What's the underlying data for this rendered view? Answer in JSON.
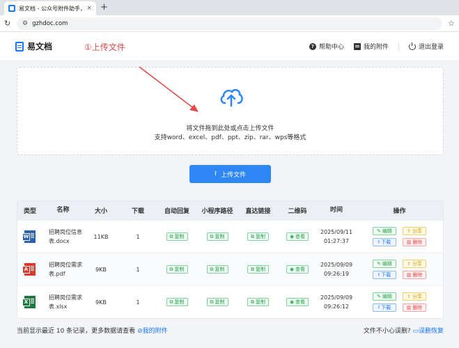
{
  "browser": {
    "tab_title": "易文档 - 公众号附件助手，一键",
    "tab_close": "×",
    "new_tab": "+",
    "url": "gzhdoc.com"
  },
  "header": {
    "logo": "易文档",
    "annotation": "①上传文件",
    "links": [
      {
        "label": "帮助中心",
        "icon": "help-icon"
      },
      {
        "label": "我的附件",
        "icon": "file-icon"
      },
      {
        "label": "退出登录",
        "icon": "power-icon"
      }
    ]
  },
  "upload": {
    "hint1": "将文件拖到此处或点击上传文件",
    "hint2": "支持word、excel、pdf、ppt、zip、rar、wps等格式",
    "button": "上传文件"
  },
  "table": {
    "headers": [
      "类型",
      "名称",
      "大小",
      "下载",
      "自动回复",
      "小程序路径",
      "直达链接",
      "二维码",
      "时间",
      "操作"
    ],
    "rows": [
      {
        "type": "word",
        "type_letter": "W",
        "name": "招聘岗位信息表.docx",
        "size": "11KB",
        "downloads": "1",
        "auto": "复制",
        "mini": "复制",
        "link": "复制",
        "qr": "查看",
        "time": "2025/09/11 01:27:37"
      },
      {
        "type": "pdf",
        "type_letter": "A",
        "name": "招聘岗位需求表.pdf",
        "size": "9KB",
        "downloads": "1",
        "auto": "复制",
        "mini": "复制",
        "link": "复制",
        "qr": "查看",
        "time": "2025/09/09 09:26:19"
      },
      {
        "type": "xls",
        "type_letter": "X",
        "name": "招聘岗位需求表.xlsx",
        "size": "9KB",
        "downloads": "1",
        "auto": "复制",
        "mini": "复制",
        "link": "复制",
        "qr": "查看",
        "time": "2025/09/09 09:26:12"
      }
    ],
    "ops": {
      "edit": "编辑",
      "share": "分享",
      "download": "下载",
      "delete": "删除"
    }
  },
  "footer": {
    "left_text": "当前显示最近 10 条记录，更多数据请查看",
    "left_link": "我的附件",
    "right_text": "文件不小心误删?",
    "right_link": "误删恢复"
  },
  "colors": {
    "accent": "#2f86f6",
    "annotation": "#e24a4a",
    "green": "#2aa050"
  }
}
